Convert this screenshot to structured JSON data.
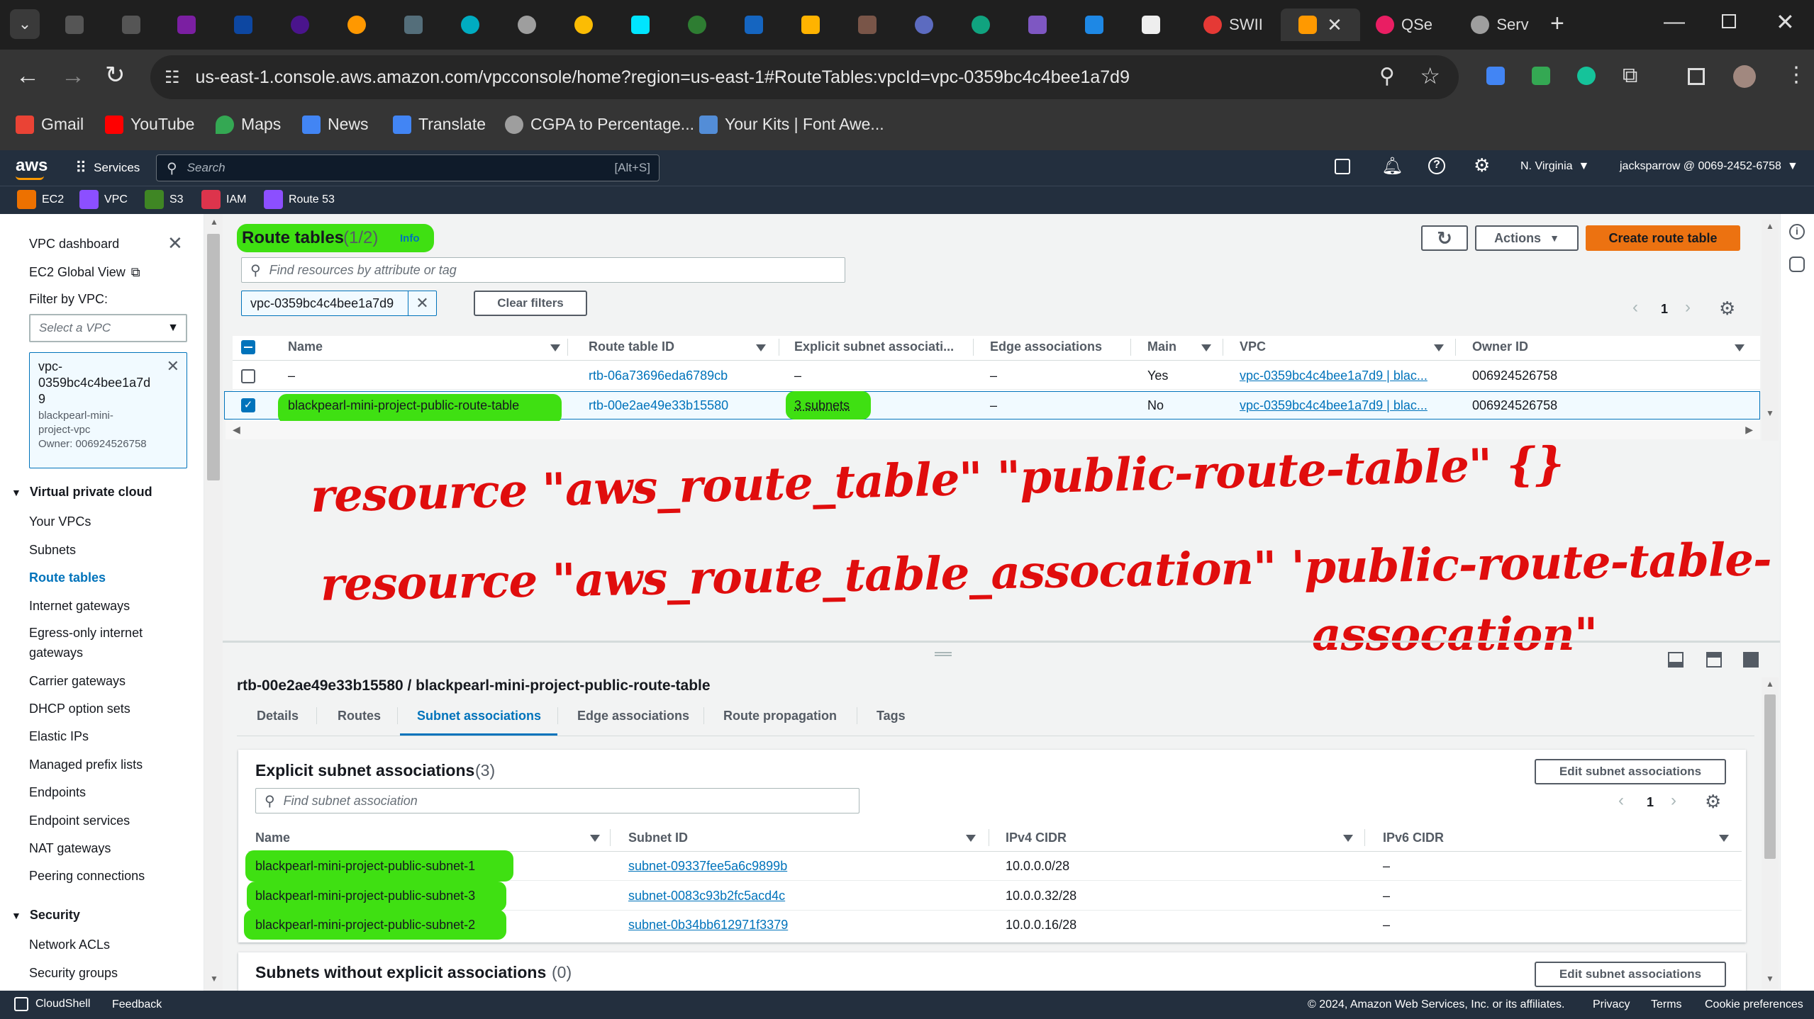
{
  "browser": {
    "tabs": [
      {
        "label": "SWII",
        "icon": "app-icon"
      },
      {
        "label": "",
        "icon": "aws-icon",
        "active": true
      },
      {
        "label": "QSe",
        "icon": "app-icon"
      },
      {
        "label": "Serv",
        "icon": "globe-icon"
      }
    ],
    "address": "us-east-1.console.aws.amazon.com/vpcconsole/home?region=us-east-1#RouteTables:vpcId=vpc-0359bc4c4bee1a7d9",
    "bookmarks": [
      "Gmail",
      "YouTube",
      "Maps",
      "News",
      "Translate",
      "CGPA to Percentage...",
      "Your Kits | Font Awe..."
    ]
  },
  "aws": {
    "logo": "aws",
    "services_label": "Services",
    "search_placeholder": "Search",
    "search_shortcut": "[Alt+S]",
    "region": "N. Virginia",
    "account": "jacksparrow @ 0069-2452-6758",
    "favorites": [
      "EC2",
      "VPC",
      "S3",
      "IAM",
      "Route 53"
    ],
    "favorite_colors": [
      "#ed7100",
      "#8c4fff",
      "#3f8624",
      "#dd344c",
      "#8c4fff"
    ]
  },
  "sidebar": {
    "dashboard": "VPC dashboard",
    "ec2_global": "EC2 Global View",
    "filter_label": "Filter by VPC:",
    "vpc_select_placeholder": "Select a VPC",
    "vpc_chip": {
      "id_line1": "vpc-",
      "id_line2": "0359bc4c4bee1a7d",
      "id_line3": "9",
      "name_line1": "blackpearl-mini-",
      "name_line2": "project-vpc",
      "owner": "Owner: 006924526758"
    },
    "section_vpc": "Virtual private cloud",
    "vpc_items": [
      "Your VPCs",
      "Subnets",
      "Route tables",
      "Internet gateways",
      "Egress-only internet",
      "gateways",
      "Carrier gateways",
      "DHCP option sets",
      "Elastic IPs",
      "Managed prefix lists",
      "Endpoints",
      "Endpoint services",
      "NAT gateways",
      "Peering connections"
    ],
    "section_security": "Security",
    "security_items": [
      "Network ACLs",
      "Security groups"
    ]
  },
  "route_tables": {
    "title": "Route tables",
    "count": "(1/2)",
    "info": "Info",
    "actions_label": "Actions",
    "create_label": "Create route table",
    "search_placeholder": "Find resources by attribute or tag",
    "filter_chip": "vpc-0359bc4c4bee1a7d9",
    "clear_filters": "Clear filters",
    "page": "1",
    "columns": [
      "Name",
      "Route table ID",
      "Explicit subnet associati...",
      "Edge associations",
      "Main",
      "VPC",
      "Owner ID"
    ],
    "rows": [
      {
        "name": "–",
        "id": "rtb-06a73696eda6789cb",
        "explicit": "–",
        "edge": "–",
        "main": "Yes",
        "vpc": "vpc-0359bc4c4bee1a7d9 | blac...",
        "owner": "006924526758"
      },
      {
        "name": "blackpearl-mini-project-public-route-table",
        "id": "rtb-00e2ae49e33b15580",
        "explicit": "3 subnets",
        "edge": "–",
        "main": "No",
        "vpc": "vpc-0359bc4c4bee1a7d9 | blac...",
        "owner": "006924526758"
      }
    ]
  },
  "annotation": {
    "line1": "resource \"aws_route_table\" \"public-route-table\" {}",
    "line2a": "resource \"aws_route_table_assocation\" 'public-route-table-",
    "line2b": "assocation\""
  },
  "detail": {
    "heading": "rtb-00e2ae49e33b15580 / blackpearl-mini-project-public-route-table",
    "tabs": [
      "Details",
      "Routes",
      "Subnet associations",
      "Edge associations",
      "Route propagation",
      "Tags"
    ],
    "explicit_title": "Explicit subnet associations",
    "explicit_count": "(3)",
    "edit_label": "Edit subnet associations",
    "search_placeholder": "Find subnet association",
    "page": "1",
    "columns": [
      "Name",
      "Subnet ID",
      "IPv4 CIDR",
      "IPv6 CIDR"
    ],
    "rows": [
      {
        "name": "blackpearl-mini-project-public-subnet-1",
        "subnet": "subnet-09337fee5a6c9899b",
        "ipv4": "10.0.0.0/28",
        "ipv6": "–"
      },
      {
        "name": "blackpearl-mini-project-public-subnet-3",
        "subnet": "subnet-0083c93b2fc5acd4c",
        "ipv4": "10.0.0.32/28",
        "ipv6": "–"
      },
      {
        "name": "blackpearl-mini-project-public-subnet-2",
        "subnet": "subnet-0b34bb612971f3379",
        "ipv4": "10.0.0.16/28",
        "ipv6": "–"
      }
    ],
    "without_title": "Subnets without explicit associations",
    "without_count": "(0)",
    "edit_label2": "Edit subnet associations"
  },
  "footer": {
    "cloudshell": "CloudShell",
    "feedback": "Feedback",
    "copyright": "© 2024, Amazon Web Services, Inc. or its affiliates.",
    "privacy": "Privacy",
    "terms": "Terms",
    "cookies": "Cookie preferences"
  }
}
